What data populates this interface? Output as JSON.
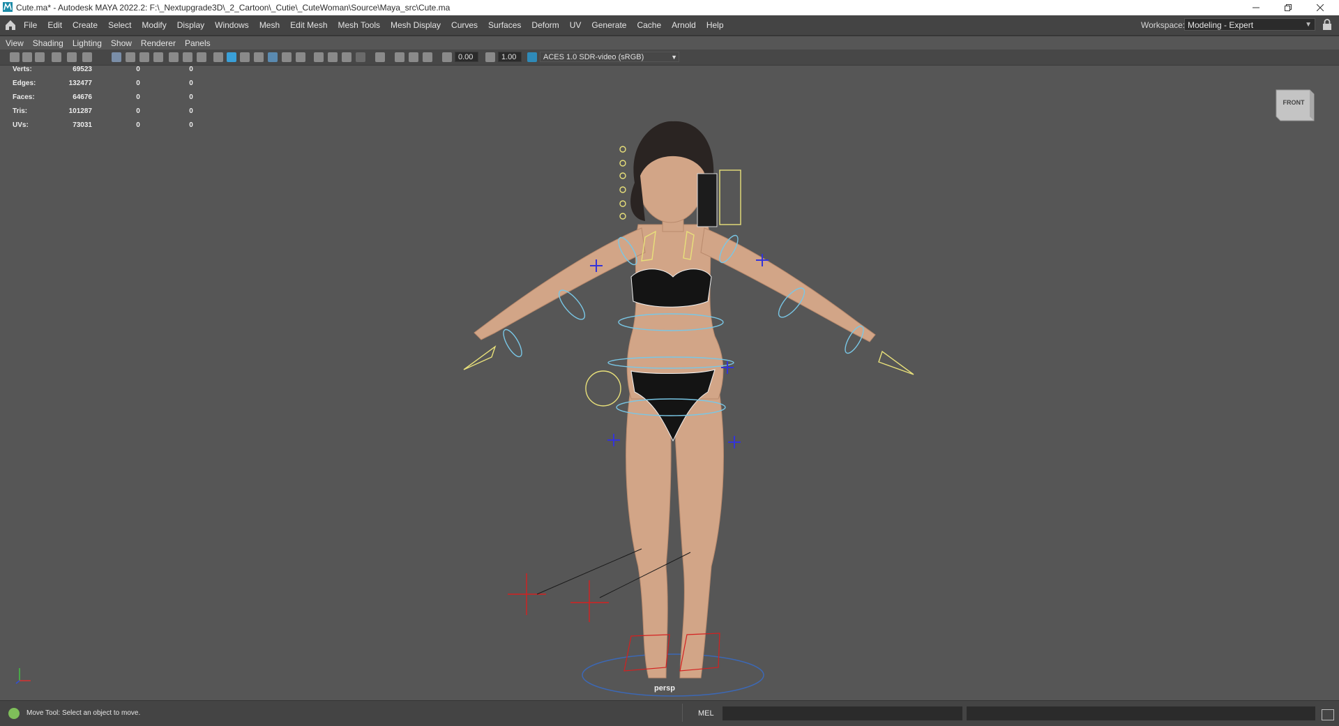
{
  "window": {
    "title": "Cute.ma* - Autodesk MAYA 2022.2: F:\\_Nextupgrade3D\\_2_Cartoon\\_Cutie\\_CuteWoman\\Source\\Maya_src\\Cute.ma",
    "icons": [
      "maya-app-icon",
      "minimize-icon",
      "restore-icon",
      "close-icon"
    ]
  },
  "menubar": {
    "items": [
      "File",
      "Edit",
      "Create",
      "Select",
      "Modify",
      "Display",
      "Windows",
      "Mesh",
      "Edit Mesh",
      "Mesh Tools",
      "Mesh Display",
      "Curves",
      "Surfaces",
      "Deform",
      "UV",
      "Generate",
      "Cache",
      "Arnold",
      "Help"
    ],
    "workspace_label": "Workspace:",
    "workspace_value": "Modeling - Expert"
  },
  "viewport": {
    "menu": [
      "View",
      "Shading",
      "Lighting",
      "Show",
      "Renderer",
      "Panels"
    ],
    "toolbar": {
      "field_a": "0.00",
      "field_b": "1.00",
      "colorspace": "ACES 1.0 SDR-video (sRGB)"
    },
    "hud": [
      {
        "label": "Verts:",
        "v1": "69523",
        "v2": "0",
        "v3": "0"
      },
      {
        "label": "Edges:",
        "v1": "132477",
        "v2": "0",
        "v3": "0"
      },
      {
        "label": "Faces:",
        "v1": "64676",
        "v2": "0",
        "v3": "0"
      },
      {
        "label": "Tris:",
        "v1": "101287",
        "v2": "0",
        "v3": "0"
      },
      {
        "label": "UVs:",
        "v1": "73031",
        "v2": "0",
        "v3": "0"
      }
    ],
    "viewcube_label": "FRONT",
    "camera": "persp",
    "colors": {
      "rig_cyan": "#79c7e6",
      "rig_yellow": "#e8e07a",
      "rig_red": "#d42020",
      "rig_blue": "#3030d8",
      "skin": "#d6a98c"
    }
  },
  "statusbar": {
    "help_line": "Move Tool: Select an object to move.",
    "script_lang": "MEL"
  }
}
